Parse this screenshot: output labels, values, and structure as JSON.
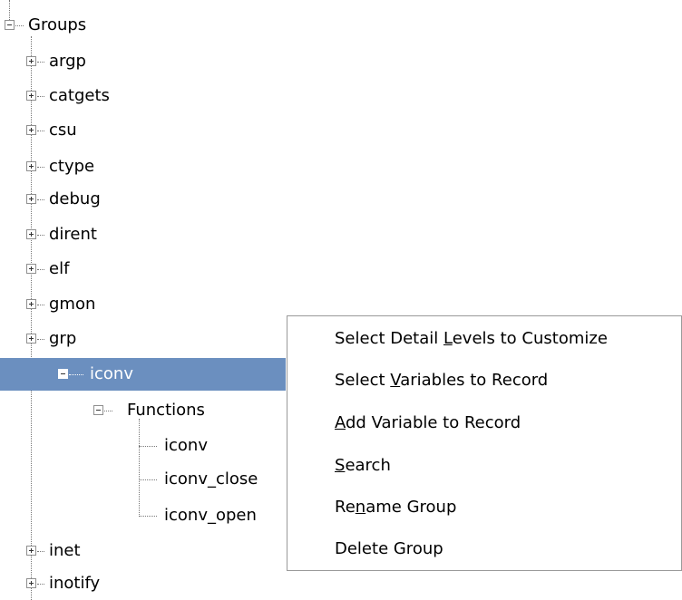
{
  "tree": {
    "root": {
      "label": "Groups"
    },
    "groups": [
      {
        "label": "argp"
      },
      {
        "label": "catgets"
      },
      {
        "label": "csu"
      },
      {
        "label": "ctype"
      },
      {
        "label": "debug"
      },
      {
        "label": "dirent"
      },
      {
        "label": "elf"
      },
      {
        "label": "gmon"
      },
      {
        "label": "grp"
      },
      {
        "label": "iconv"
      },
      {
        "label": "inet"
      },
      {
        "label": "inotify"
      }
    ],
    "iconv_children": {
      "functions_label": "Functions",
      "functions": [
        {
          "label": "iconv"
        },
        {
          "label": "iconv_close"
        },
        {
          "label": "iconv_open"
        }
      ]
    }
  },
  "context_menu": {
    "items": [
      {
        "before": "Select Detail ",
        "mnemonic": "L",
        "after": "evels to Customize"
      },
      {
        "before": "Select ",
        "mnemonic": "V",
        "after": "ariables to Record"
      },
      {
        "before": "",
        "mnemonic": "A",
        "after": "dd Variable to Record"
      },
      {
        "before": "",
        "mnemonic": "S",
        "after": "earch"
      },
      {
        "before": "Re",
        "mnemonic": "n",
        "after": "ame Group"
      },
      {
        "before": "Delete Group",
        "mnemonic": "",
        "after": ""
      }
    ]
  }
}
